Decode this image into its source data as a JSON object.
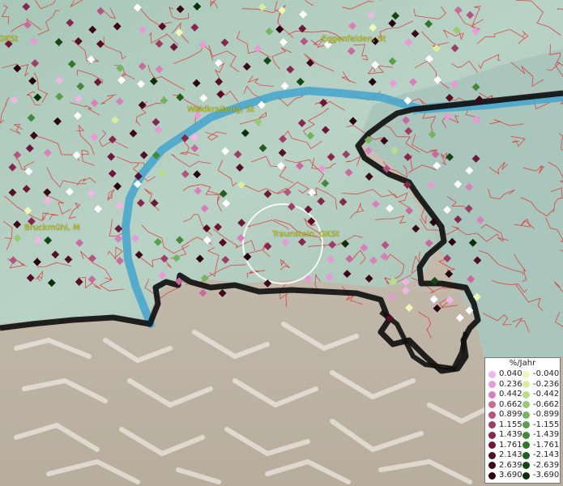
{
  "map": {
    "places": [
      {
        "id": "p1",
        "label": "GKSt"
      },
      {
        "id": "p2",
        "label": "Eggenfelden, St"
      },
      {
        "id": "p3",
        "label": "Waldkraiburg, St"
      },
      {
        "id": "p4",
        "label": "Bruckmühl, M"
      },
      {
        "id": "p5",
        "label": "Traunstein, GKSt"
      }
    ],
    "colors": {
      "pos": [
        "#f2b5e8",
        "#e89ad6",
        "#d880bb",
        "#c86a9e",
        "#b35582",
        "#9c3f66",
        "#86284d",
        "#6d183a",
        "#551028",
        "#3e081a",
        "#280310"
      ],
      "neg": [
        "#eef7b8",
        "#d8eda0",
        "#b8dd8a",
        "#97c977",
        "#76b463",
        "#5c9e4f",
        "#45893e",
        "#33742e",
        "#225e20",
        "#154814",
        "#0a3009"
      ],
      "border": "#111111",
      "river": "#4aa6cc",
      "admin_lines": "#e03030"
    }
  },
  "legend": {
    "title": "%/Jahr",
    "positive": [
      "0.040",
      "0.236",
      "0.442",
      "0.662",
      "0.899",
      "1.155",
      "1.439",
      "1.761",
      "2.143",
      "2.639",
      "3.690"
    ],
    "negative": [
      "-0.040",
      "-0.236",
      "-0.442",
      "-0.662",
      "-0.899",
      "-1.155",
      "-1.439",
      "-1.761",
      "-2.143",
      "-2.639",
      "-3.690"
    ]
  }
}
